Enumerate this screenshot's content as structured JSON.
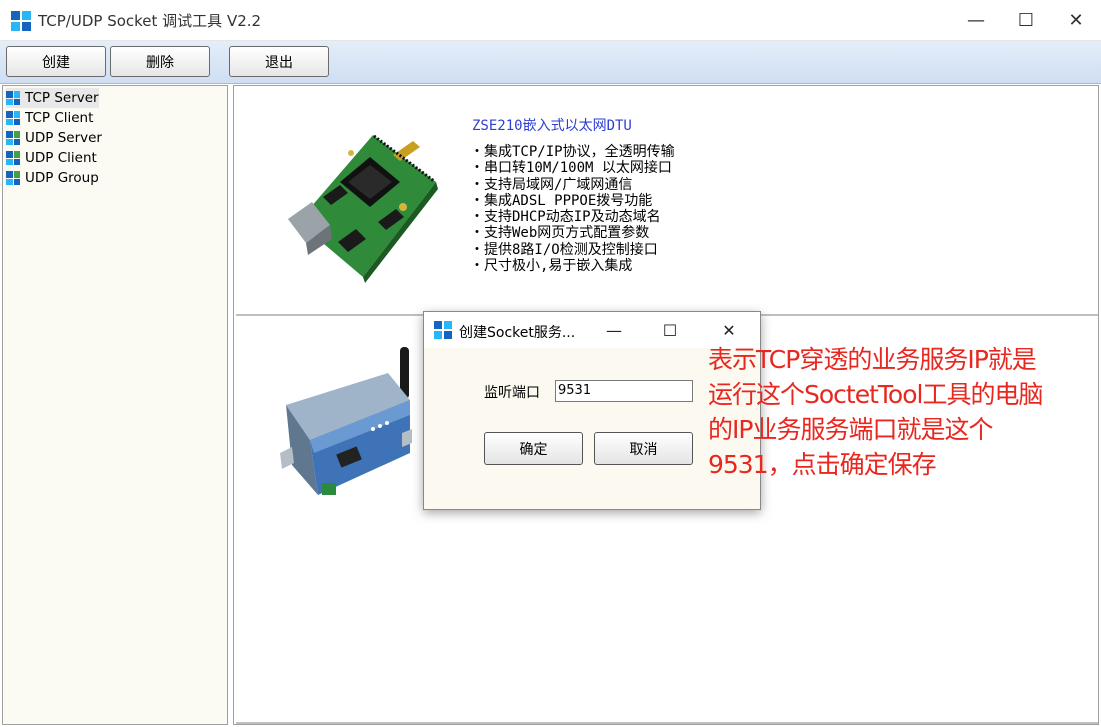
{
  "window": {
    "title": "TCP/UDP Socket 调试工具 V2.2",
    "min": "—",
    "max": "☐",
    "close": "✕"
  },
  "toolbar": {
    "create": "创建",
    "delete": "删除",
    "exit": "退出"
  },
  "tree": {
    "items": [
      {
        "label": "TCP Server"
      },
      {
        "label": "TCP Client"
      },
      {
        "label": "UDP Server"
      },
      {
        "label": "UDP Client"
      },
      {
        "label": "UDP Group"
      }
    ]
  },
  "product": {
    "title": "ZSE210嵌入式以太网DTU",
    "features": [
      "・集成TCP/IP协议，全透明传输",
      "・串口转10M/100M 以太网接口",
      "・支持局域网/广域网通信",
      "・集成ADSL PPPOE拨号功能",
      "・支持DHCP动态IP及动态域名",
      "・支持Web网页方式配置参数",
      "・提供8路I/O检测及控制接口",
      "・尺寸极小,易于嵌入集成"
    ]
  },
  "dialog": {
    "title": "创建Socket服务...",
    "port_label": "监听端口",
    "port_value": "9531",
    "ok": "确定",
    "cancel": "取消"
  },
  "annotation": {
    "lines": [
      "表示TCP穿透的业务服务IP就是",
      "运行这个SoctetTool工具的电脑",
      "的IP业务服务端口就是这个",
      "9531，点击确定保存"
    ],
    "color": "#e8271f"
  },
  "colors": {
    "icon_blue": "#1565c0",
    "icon_cyan": "#29b6f6",
    "icon_green": "#43a047",
    "title_blue": "#2d3ed2"
  }
}
